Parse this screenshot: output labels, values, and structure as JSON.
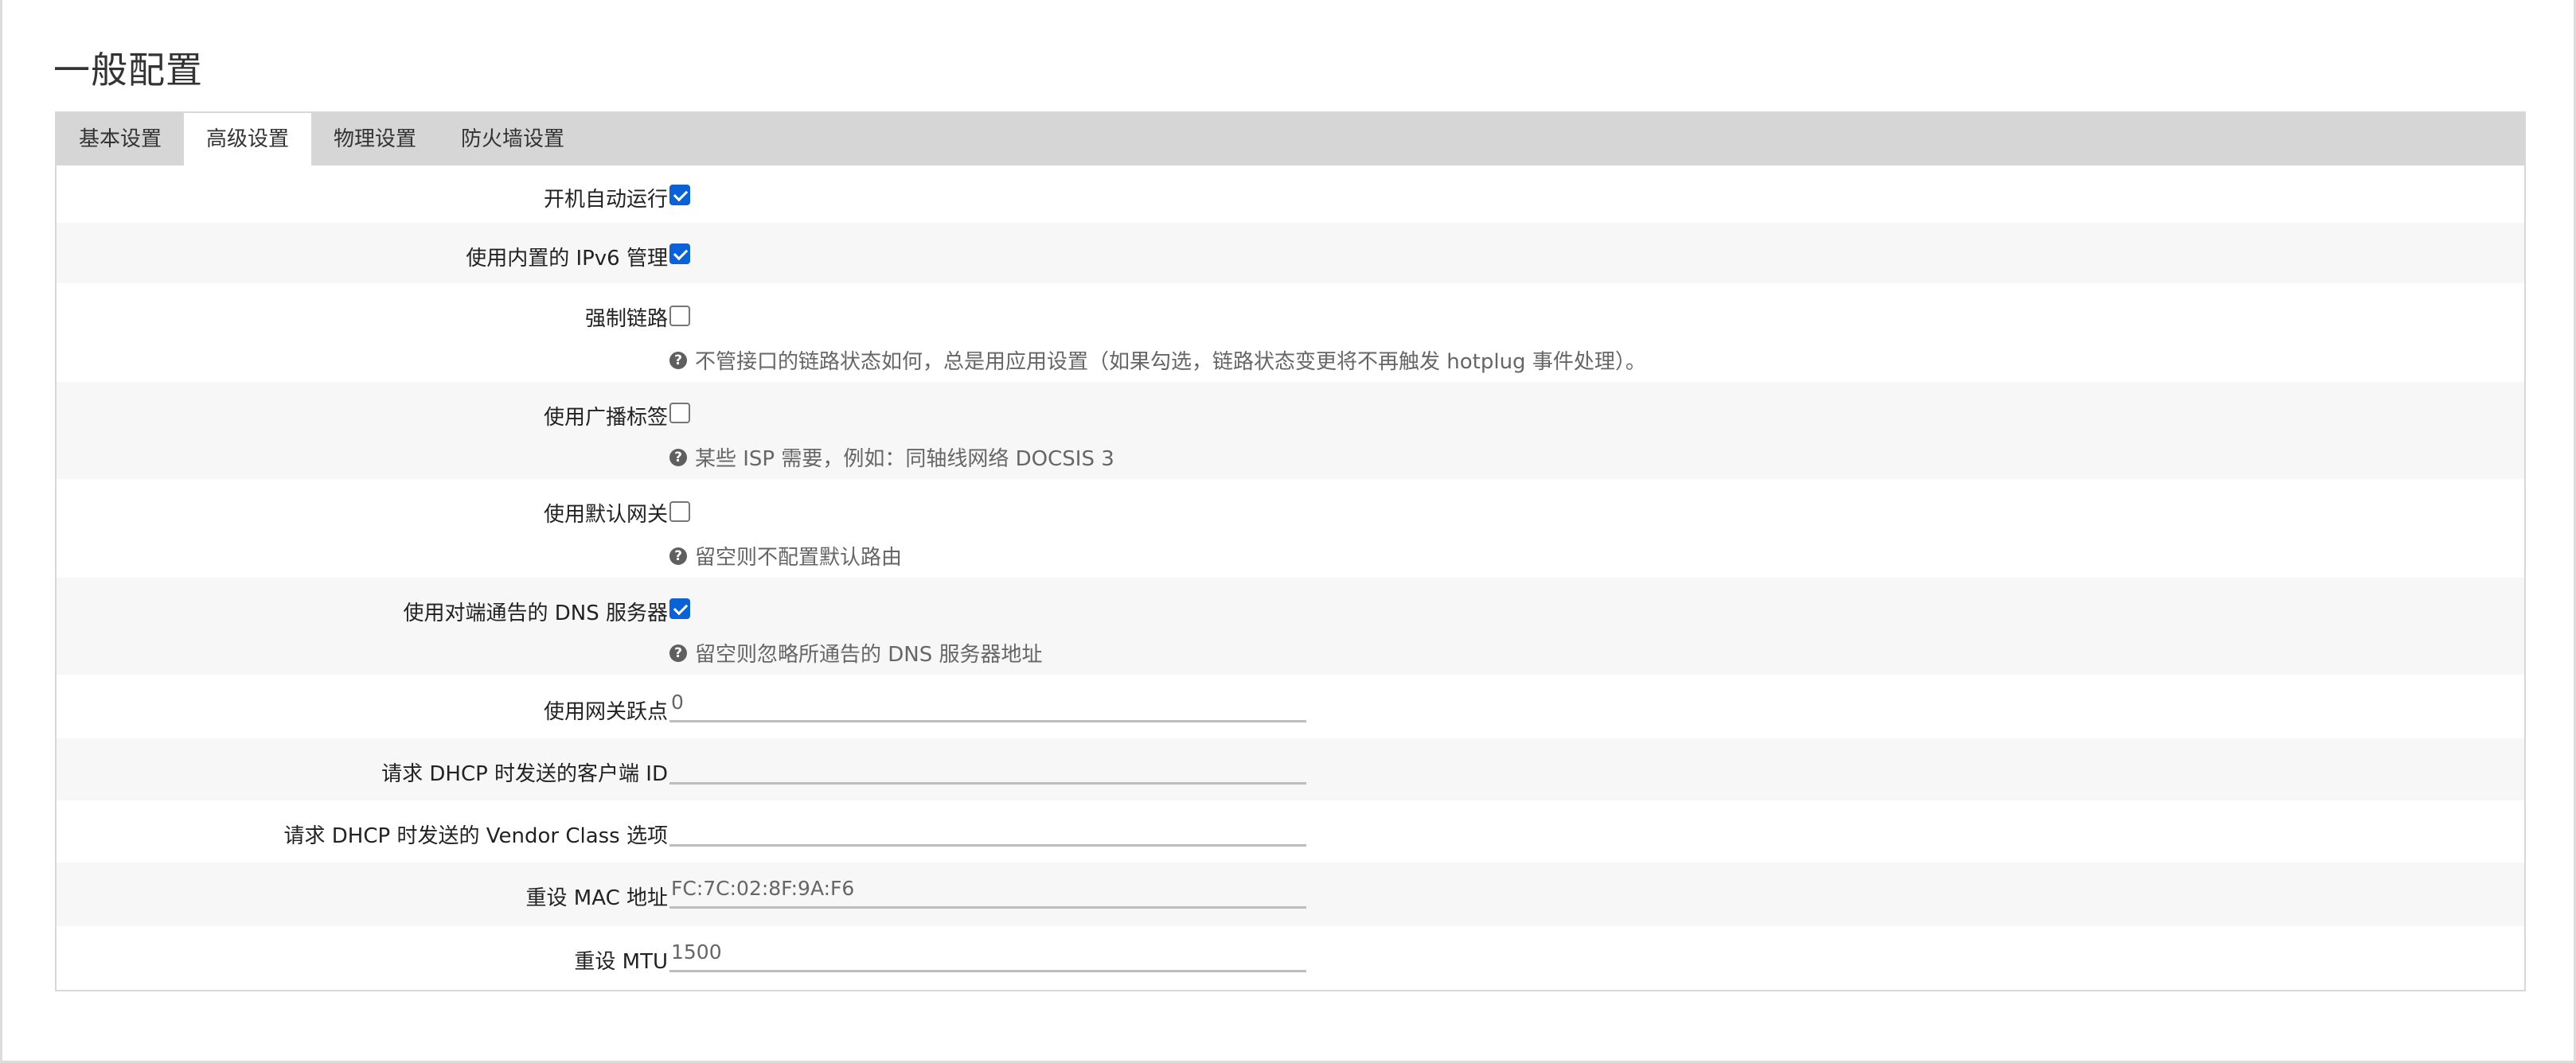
{
  "page": {
    "title": "一般配置"
  },
  "tabs": [
    {
      "label": "基本设置",
      "active": false
    },
    {
      "label": "高级设置",
      "active": true
    },
    {
      "label": "物理设置",
      "active": false
    },
    {
      "label": "防火墙设置",
      "active": false
    }
  ],
  "settings": {
    "auto_start": {
      "label": "开机自动运行",
      "checked": true
    },
    "ipv6_builtin": {
      "label": "使用内置的 IPv6 管理",
      "checked": true
    },
    "force_link": {
      "label": "强制链路",
      "checked": false,
      "hint": "不管接口的链路状态如何，总是用应用设置（如果勾选，链路状态变更将不再触发 hotplug 事件处理）。"
    },
    "broadcast_flag": {
      "label": "使用广播标签",
      "checked": false,
      "hint": "某些 ISP 需要，例如：同轴线网络 DOCSIS 3"
    },
    "default_gateway": {
      "label": "使用默认网关",
      "checked": false,
      "hint": "留空则不配置默认路由"
    },
    "peer_dns": {
      "label": "使用对端通告的 DNS 服务器",
      "checked": true,
      "hint": "留空则忽略所通告的 DNS 服务器地址"
    },
    "gateway_metric": {
      "label": "使用网关跃点",
      "value": "0"
    },
    "dhcp_client_id": {
      "label": "请求 DHCP 时发送的客户端 ID",
      "value": ""
    },
    "dhcp_vendor_class": {
      "label": "请求 DHCP 时发送的 Vendor Class 选项",
      "value": ""
    },
    "mac_override": {
      "label": "重设 MAC 地址",
      "value": "FC:7C:02:8F:9A:F6"
    },
    "mtu_override": {
      "label": "重设 MTU",
      "value": "1500"
    }
  },
  "colors": {
    "accent": "#0a62d6",
    "tabbar": "#d6d6d6",
    "row_alt": "#f7f7f7"
  },
  "icons": {
    "hint": "question-circle-icon"
  }
}
